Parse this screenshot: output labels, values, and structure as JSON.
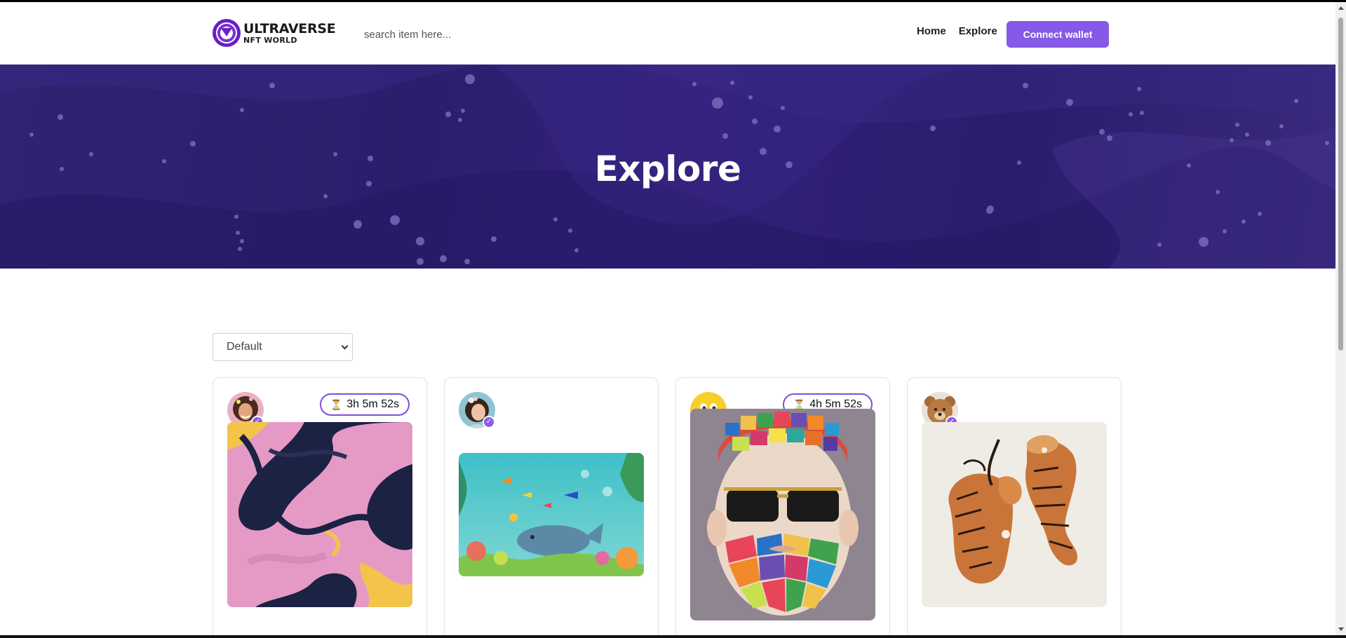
{
  "brand": {
    "line1": "ULTRAVERSE",
    "line2": "NFT WORLD"
  },
  "search": {
    "placeholder": "search item here..."
  },
  "nav": {
    "home": "Home",
    "explore": "Explore"
  },
  "connect_button": "Connect wallet",
  "hero": {
    "title": "Explore"
  },
  "sort": {
    "selected": "Default"
  },
  "cards": [
    {
      "timer": "3h 5m 52s",
      "avatar": "woman-avatar",
      "artwork": "pink-yellow-fluid-art"
    },
    {
      "timer": "",
      "avatar": "girl-avatar",
      "artwork": "underwater-whale-art"
    },
    {
      "timer": "4h 5m 52s",
      "avatar": "smiley-emoji-avatar",
      "artwork": "mosaic-beard-man-art"
    },
    {
      "timer": "",
      "avatar": "teddy-bear-avatar",
      "artwork": "two-tigers-art"
    }
  ],
  "colors": {
    "accent": "#8659e6",
    "hero_bg": "#2b1e6d"
  }
}
